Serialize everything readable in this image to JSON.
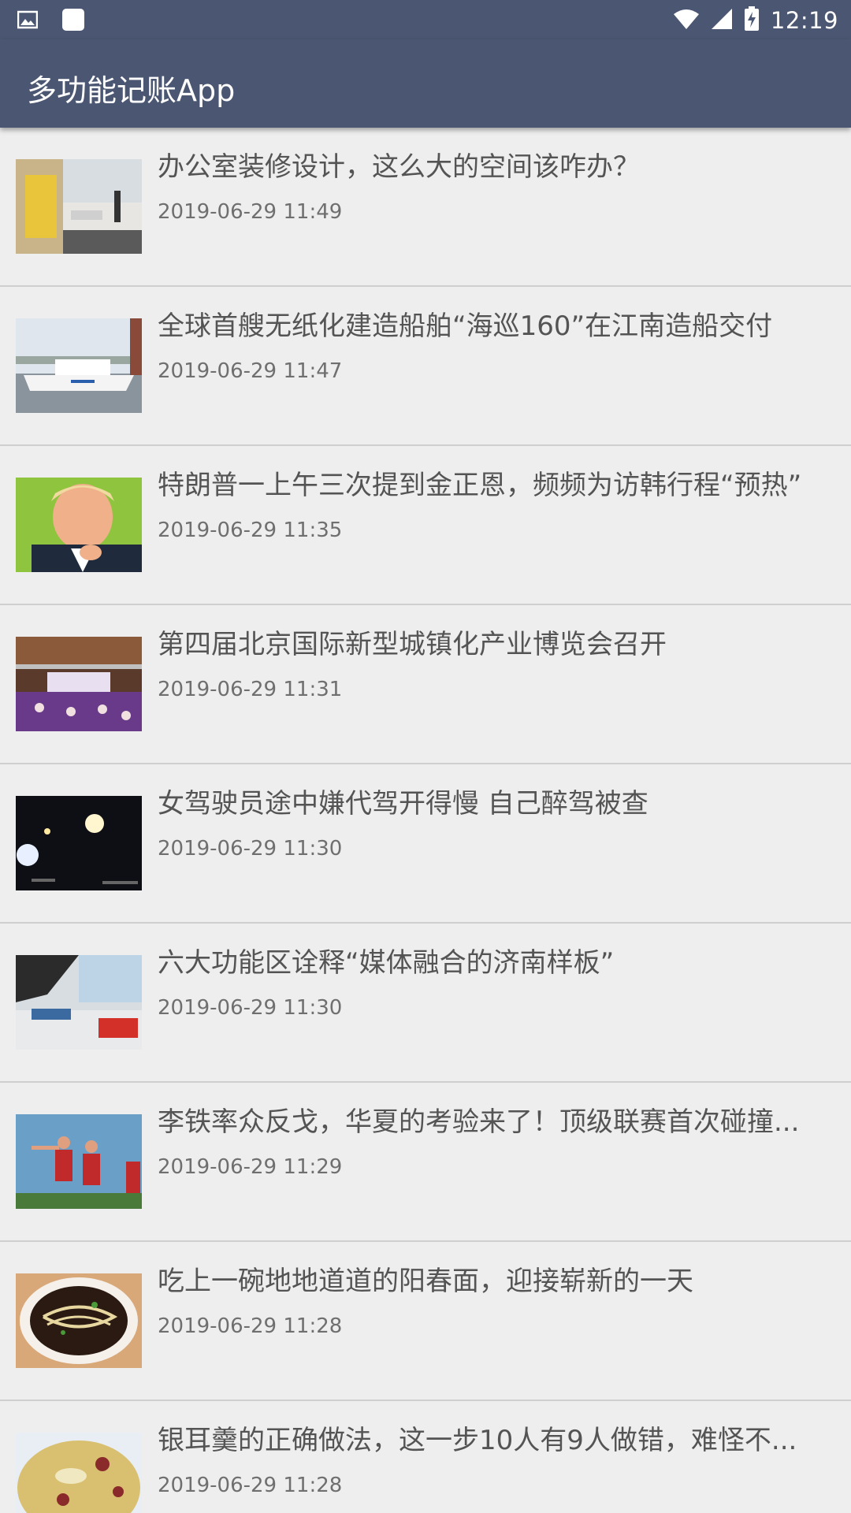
{
  "status_bar": {
    "time": "12:19",
    "icons": [
      "image-notification-icon",
      "app-notification-icon",
      "wifi-icon",
      "cell-signal-icon",
      "battery-charging-icon"
    ]
  },
  "app_bar": {
    "title": "多功能记账App",
    "color": "#4b5772"
  },
  "news": [
    {
      "title": "办公室装修设计，这么大的空间该咋办？",
      "time": "2019-06-29 11:49",
      "thumb": "office-photo"
    },
    {
      "title": "全球首艘无纸化建造船舶“海巡160”在江南造船交付",
      "time": "2019-06-29 11:47",
      "thumb": "ship-photo"
    },
    {
      "title": "特朗普一上午三次提到金正恩，频频为访韩行程“预热”",
      "time": "2019-06-29 11:35",
      "thumb": "portrait-photo"
    },
    {
      "title": "第四届北京国际新型城镇化产业博览会召开",
      "time": "2019-06-29 11:31",
      "thumb": "expo-photo"
    },
    {
      "title": "女驾驶员途中嫌代驾开得慢 自己醉驾被查",
      "time": "2019-06-29 11:30",
      "thumb": "night-road-photo"
    },
    {
      "title": "六大功能区诠释“媒体融合的济南样板”",
      "time": "2019-06-29 11:30",
      "thumb": "media-hall-photo"
    },
    {
      "title": "李铁率众反戈，华夏的考验来了！顶级联赛首次碰撞...",
      "time": "2019-06-29 11:29",
      "thumb": "football-photo"
    },
    {
      "title": "吃上一碗地地道道的阳春面，迎接崭新的一天",
      "time": "2019-06-29 11:28",
      "thumb": "noodles-photo"
    },
    {
      "title": "银耳羹的正确做法，这一步10人有9人做错，难怪不...",
      "time": "2019-06-29 11:28",
      "thumb": "soup-photo"
    }
  ]
}
